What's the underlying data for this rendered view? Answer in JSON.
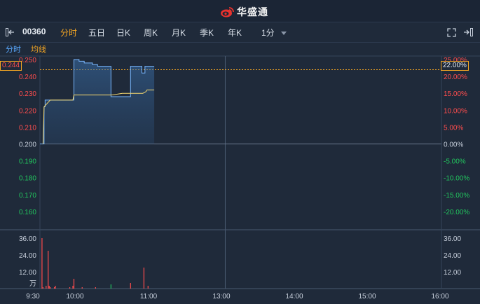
{
  "header": {
    "brand": "华盛通"
  },
  "toolbar": {
    "stock_code": "00360",
    "tabs": [
      {
        "label": "分时",
        "active": true
      },
      {
        "label": "五日",
        "active": false
      },
      {
        "label": "日K",
        "active": false
      },
      {
        "label": "周K",
        "active": false
      },
      {
        "label": "月K",
        "active": false
      },
      {
        "label": "季K",
        "active": false
      },
      {
        "label": "年K",
        "active": false
      }
    ],
    "interval": "1分"
  },
  "subbar": {
    "tab_time": "分时",
    "tab_avg": "均线"
  },
  "chart_data": {
    "type": "line",
    "prev_close": 0.2,
    "current_price": "0.244",
    "current_pct": "22.00%",
    "price_ticks": [
      "0.250",
      "0.240",
      "0.230",
      "0.220",
      "0.210",
      "0.200",
      "0.190",
      "0.180",
      "0.170",
      "0.160"
    ],
    "pct_ticks": [
      "25.00%",
      "20.00%",
      "15.00%",
      "10.00%",
      "5.00%",
      "0.00%",
      "-5.00%",
      "-10.00%",
      "-15.00%",
      "-20.00%"
    ],
    "volume_ticks": [
      "36.00",
      "24.00",
      "12.00"
    ],
    "volume_unit": "万",
    "time_ticks": [
      "9:30",
      "10:00",
      "11:00",
      "13:00",
      "14:00",
      "15:00",
      "16:00"
    ],
    "price_series": [
      [
        0,
        0.2
      ],
      [
        3,
        0.2
      ],
      [
        4,
        0.222
      ],
      [
        5,
        0.226
      ],
      [
        6,
        0.226
      ],
      [
        10,
        0.226
      ],
      [
        20,
        0.226
      ],
      [
        30,
        0.226
      ],
      [
        32,
        0.226
      ],
      [
        33,
        0.25
      ],
      [
        37,
        0.25
      ],
      [
        38,
        0.249
      ],
      [
        42,
        0.249
      ],
      [
        43,
        0.248
      ],
      [
        50,
        0.248
      ],
      [
        51,
        0.247
      ],
      [
        55,
        0.247
      ],
      [
        56,
        0.246
      ],
      [
        68,
        0.246
      ],
      [
        69,
        0.228
      ],
      [
        80,
        0.228
      ],
      [
        87,
        0.228
      ],
      [
        88,
        0.246
      ],
      [
        95,
        0.246
      ],
      [
        98,
        0.246
      ],
      [
        99,
        0.242
      ],
      [
        101,
        0.242
      ],
      [
        102,
        0.246
      ],
      [
        110,
        0.246
      ],
      [
        111,
        0.246
      ]
    ],
    "avg_series": [
      [
        3,
        0.2
      ],
      [
        4,
        0.222
      ],
      [
        10,
        0.226
      ],
      [
        20,
        0.226
      ],
      [
        30,
        0.226
      ],
      [
        32,
        0.226
      ],
      [
        33,
        0.229
      ],
      [
        40,
        0.229
      ],
      [
        50,
        0.229
      ],
      [
        60,
        0.229
      ],
      [
        70,
        0.229
      ],
      [
        80,
        0.23
      ],
      [
        90,
        0.23
      ],
      [
        100,
        0.23
      ],
      [
        103,
        0.231
      ],
      [
        104,
        0.232
      ],
      [
        111,
        0.232
      ]
    ],
    "volumes": [
      {
        "m": 2,
        "v": 36,
        "c": "red"
      },
      {
        "m": 3,
        "v": 1,
        "c": "red"
      },
      {
        "m": 6,
        "v": 2,
        "c": "red"
      },
      {
        "m": 8,
        "v": 27,
        "c": "red"
      },
      {
        "m": 9,
        "v": 2,
        "c": "red"
      },
      {
        "m": 10,
        "v": 1,
        "c": "red"
      },
      {
        "m": 14,
        "v": 1,
        "c": "red"
      },
      {
        "m": 15,
        "v": 2,
        "c": "red"
      },
      {
        "m": 29,
        "v": 1,
        "c": "red"
      },
      {
        "m": 32,
        "v": 2,
        "c": "red"
      },
      {
        "m": 33,
        "v": 7,
        "c": "red"
      },
      {
        "m": 41,
        "v": 1,
        "c": "red"
      },
      {
        "m": 54,
        "v": 1,
        "c": "red"
      },
      {
        "m": 69,
        "v": 3,
        "c": "green"
      },
      {
        "m": 88,
        "v": 4,
        "c": "red"
      },
      {
        "m": 101,
        "v": 15,
        "c": "red"
      },
      {
        "m": 105,
        "v": 2,
        "c": "red"
      }
    ],
    "colors": {
      "up": "#ff4d4d",
      "down": "#22c55e",
      "line": "#7ab8ff",
      "avg": "#f5d76e",
      "grid": "#34445a"
    }
  }
}
